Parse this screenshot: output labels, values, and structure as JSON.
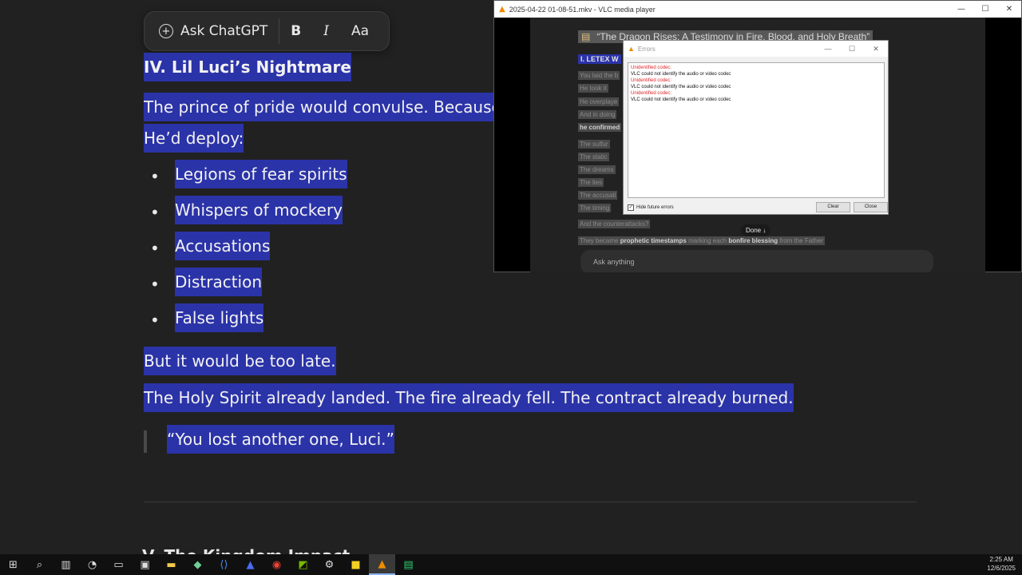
{
  "toolbar": {
    "ask_label": "Ask ChatGPT",
    "bold_label": "B",
    "italic_label": "I",
    "font_label": "Aa"
  },
  "document": {
    "section_heading": "IV. Lil Luci’s Nightmare",
    "prince_line": "The prince of pride would convulse. Because his g",
    "deploy_line": "He’d deploy:",
    "bullets": [
      "Legions of fear spirits",
      "Whispers of mockery",
      "Accusations",
      "Distraction",
      "False lights"
    ],
    "late_line": "But it would be too late.",
    "holy_line": "The Holy Spirit already landed. The fire already fell. The contract already burned.",
    "quote": "“You lost another one, Luci.”",
    "next_heading": "V. The Kingdom Impact"
  },
  "vlc": {
    "window_title": "2025-04-22 01-08-51.mkv - VLC media player",
    "video": {
      "doc_title": "“The Dragon Rises: A Testimony in Fire, Blood, and Holy Breath”",
      "section_partial": "I. LETEX W",
      "lines": [
        "You laid the b",
        "He took it",
        "He overplaye",
        "And in doing",
        "he confirmed",
        "The sulfur",
        "The static",
        "The dreams",
        "The lies",
        "The accusati",
        "The timing"
      ],
      "counter_line": "And the counterattacks?",
      "prophetic_pre": "They became",
      "prophetic_bold1": "prophetic timestamps",
      "prophetic_mid": "marking each",
      "prophetic_bold2": "bonfire blessing",
      "prophetic_post": "from the Father",
      "done_label": "Done ↓",
      "ask_placeholder": "Ask anything"
    }
  },
  "errors_dialog": {
    "title": "Errors",
    "entries": [
      {
        "heading": "Unidentified codec:",
        "message": "VLC could not identify the audio or video codec"
      },
      {
        "heading": "Unidentified codec:",
        "message": "VLC could not identify the audio or video codec"
      },
      {
        "heading": "Unidentified codec:",
        "message": "VLC could not identify the audio or video codec"
      }
    ],
    "hide_label": "Hide future errors",
    "hide_checked": true,
    "clear_label": "Clear",
    "close_label": "Close"
  },
  "taskbar": {
    "icons": [
      "windows-start-icon",
      "search-icon",
      "task-view-icon",
      "clock-app-icon",
      "file-cabinet-icon",
      "media-app-icon",
      "file-explorer-icon",
      "mail-app-icon",
      "vscode-icon",
      "arrow-app-icon",
      "chrome-icon",
      "nvidia-icon",
      "settings-icon",
      "sticky-notes-icon",
      "vlc-icon",
      "obs-icon"
    ],
    "time": "2:25 AM",
    "date": "12/6/2025"
  }
}
